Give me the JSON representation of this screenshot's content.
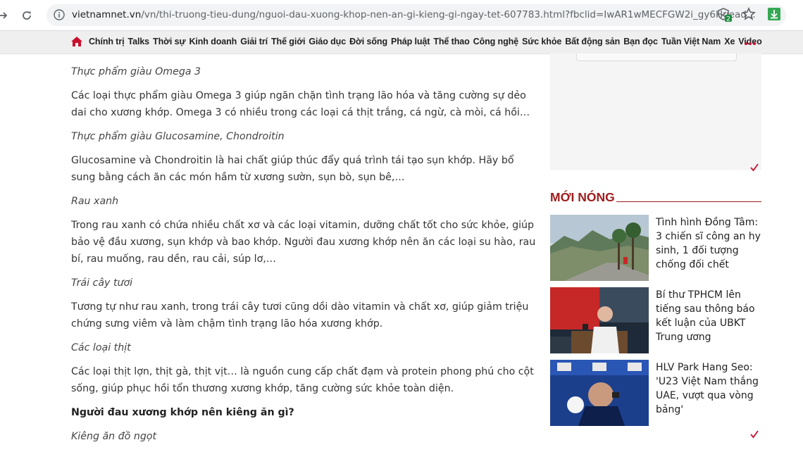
{
  "browser": {
    "url_host": "vietnamnet.vn",
    "url_path": "/vn/thi-truong-tieu-dung/nguoi-dau-xuong-khop-nen-an-gi-kieng-gi-ngay-tet-607783.html?fbclid=IwAR1wMECFGW2i_gy6Huead...",
    "extension_badge": "2"
  },
  "menu": {
    "items": [
      "Chính trị",
      "Talks",
      "Thời sự",
      "Kinh doanh",
      "Giải trí",
      "Thế giới",
      "Giáo dục",
      "Đời sống",
      "Pháp luật",
      "Thể thao",
      "Công nghệ",
      "Sức khỏe",
      "Bất động sản",
      "Bạn đọc",
      "Tuần Việt Nam",
      "Xe",
      "Video"
    ],
    "more": "•••"
  },
  "article": {
    "blocks": [
      {
        "style": "italic",
        "text": "Thực phẩm giàu Omega 3"
      },
      {
        "style": "normal",
        "text": "Các loại thực phẩm giàu Omega 3 giúp ngăn chặn tình trạng lão hóa và tăng cường sự dẻo dai cho xương khớp. Omega 3 có nhiều trong các loại cá thịt trắng, cá ngừ, cà mòi, cá hồi…"
      },
      {
        "style": "italic",
        "text": "Thực phẩm giàu Glucosamine, Chondroitin"
      },
      {
        "style": "normal",
        "text": "Glucosamine và Chondroitin là hai chất giúp thúc đẩy quá trình tái tạo sụn khớp. Hãy bổ sung bằng cách ăn các món hầm từ xương sườn, sụn bò, sụn bê,…"
      },
      {
        "style": "italic",
        "text": "Rau xanh"
      },
      {
        "style": "normal",
        "text": "Trong rau xanh có chứa nhiều chất xơ và các loại vitamin, dưỡng chất tốt cho sức khỏe, giúp bảo vệ đầu xương, sụn khớp và bao khớp. Người đau xương khớp nên ăn các loại su hào, rau bí, rau muống, rau dền, rau cải, súp lơ,…"
      },
      {
        "style": "italic",
        "text": "Trái cây tươi"
      },
      {
        "style": "normal",
        "text": "Tương tự như rau xanh, trong trái cây tươi cũng dồi dào vitamin và chất xơ, giúp giảm triệu chứng sưng viêm và làm chậm tình trạng lão hóa xương khớp."
      },
      {
        "style": "italic",
        "text": "Các loại thịt"
      },
      {
        "style": "normal",
        "text": "Các loại thịt lợn, thịt gà, thịt vịt… là nguồn cung cấp chất đạm và protein phong phú cho cột sống, giúp phục hồi tổn thương xương khớp, tăng cường sức khỏe toàn diện."
      },
      {
        "style": "bold",
        "text": "Người đau xương khớp nên kiêng ăn gì?"
      },
      {
        "style": "italic",
        "text": "Kiêng ăn đồ ngọt"
      }
    ]
  },
  "sidebar": {
    "section_title": "MỚI NÓNG",
    "news": [
      {
        "title": "Tình hình Đồng Tâm: 3 chiến sĩ công an hy sinh, 1 đối tượng chống đối chết"
      },
      {
        "title": "Bí thư TPHCM lên tiếng sau thông báo kết luận của UBKT Trung ương"
      },
      {
        "title": "HLV Park Hang Seo: 'U23 Việt Nam thắng UAE, vượt qua vòng bảng'"
      }
    ]
  },
  "colors": {
    "brand_red": "#9e1c1c",
    "menu_bg": "#efefef",
    "text": "#333333"
  }
}
